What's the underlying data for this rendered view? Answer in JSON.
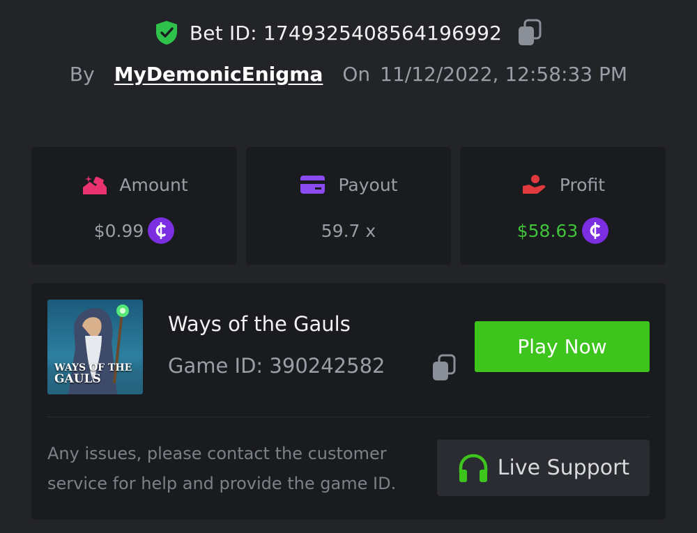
{
  "header": {
    "bet_id_label": "Bet ID: 1749325408564196992",
    "by_label": "By",
    "username": "MyDemonicEnigma",
    "on_label": "On",
    "datetime": "11/12/2022, 12:58:33 PM"
  },
  "stats": {
    "amount": {
      "label": "Amount",
      "value": "$0.99",
      "icon": "amount-icon"
    },
    "payout": {
      "label": "Payout",
      "value": "59.7 x",
      "icon": "card-icon"
    },
    "profit": {
      "label": "Profit",
      "value": "$58.63",
      "icon": "profit-icon"
    }
  },
  "game": {
    "thumbnail_title_line1": "WAYS OF THE",
    "thumbnail_title_line2": "GAULS",
    "name": "Ways of the Gauls",
    "game_id_label": "Game ID: 390242582",
    "play_button": "Play Now",
    "help_text": "Any issues, please contact the customer service for help and provide the game ID.",
    "support_button": "Live Support"
  },
  "colors": {
    "background": "#232428",
    "card": "#1a1b1e",
    "accent_green": "#3dc41d",
    "profit_green": "#3fc43a",
    "coin_purple": "#7b2fe0",
    "amount_pink": "#e8336f",
    "payout_purple": "#8a4cf0",
    "profit_red": "#e0393e"
  },
  "icons": [
    "shield-check-icon",
    "copy-icon",
    "amount-icon",
    "card-icon",
    "profit-icon",
    "coin-icon",
    "headphones-icon"
  ]
}
